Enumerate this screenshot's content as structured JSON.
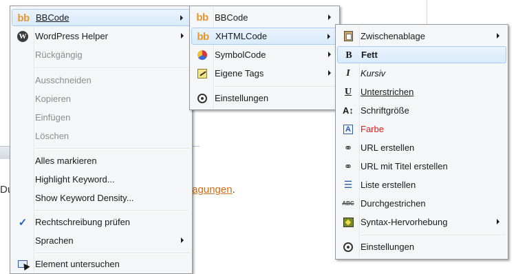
{
  "background": {
    "left_text": "Du",
    "link_text": "tragungen",
    "after_link": "."
  },
  "main_menu": {
    "items": [
      {
        "label": "BBCode",
        "icon": "bbcode-icon",
        "submenu": true,
        "highlighted": true
      },
      {
        "label": "WordPress Helper",
        "icon": "wordpress-icon",
        "submenu": true
      },
      {
        "label": "Rückgängig",
        "disabled": true
      },
      {
        "label": "Ausschneiden",
        "disabled": true
      },
      {
        "label": "Kopieren",
        "disabled": true
      },
      {
        "label": "Einfügen",
        "disabled": true
      },
      {
        "label": "Löschen",
        "disabled": true
      },
      {
        "label": "Alles markieren"
      },
      {
        "label": "Highlight Keyword..."
      },
      {
        "label": "Show Keyword Density..."
      },
      {
        "label": "Rechtschreibung prüfen",
        "icon": "checkmark-icon"
      },
      {
        "label": "Sprachen",
        "submenu": true
      },
      {
        "label": "Element untersuchen",
        "icon": "inspect-element-icon"
      }
    ]
  },
  "bbcode_menu": {
    "items": [
      {
        "label": "BBCode",
        "icon": "bbcode-icon",
        "submenu": true
      },
      {
        "label": "XHTMLCode",
        "icon": "bbcode-icon",
        "submenu": true,
        "highlighted": true
      },
      {
        "label": "SymbolCode",
        "icon": "symbol-icon",
        "submenu": true
      },
      {
        "label": "Eigene Tags",
        "icon": "tags-icon",
        "submenu": true
      },
      {
        "label": "Einstellungen",
        "icon": "settings-icon"
      }
    ]
  },
  "xhtml_menu": {
    "items": [
      {
        "label": "Zwischenablage",
        "icon": "clipboard-icon",
        "submenu": true
      },
      {
        "label": "Fett",
        "icon": "bold-icon",
        "icon_glyph": "B",
        "highlighted": true
      },
      {
        "label": "Kursiv",
        "icon": "italic-icon",
        "icon_glyph": "I"
      },
      {
        "label": "Unterstrichen",
        "icon": "underline-icon",
        "icon_glyph": "U"
      },
      {
        "label": "Schriftgröße",
        "icon": "font-size-icon",
        "icon_glyph": "A↕"
      },
      {
        "label": "Farbe",
        "icon": "color-icon",
        "icon_glyph": "A",
        "color": "#e01a1a"
      },
      {
        "label": "URL erstellen",
        "icon": "link-icon"
      },
      {
        "label": "URL mit Titel erstellen",
        "icon": "link-icon"
      },
      {
        "label": "Liste erstellen",
        "icon": "list-icon"
      },
      {
        "label": "Durchgestrichen",
        "icon": "strikethrough-icon",
        "icon_glyph": "ABC"
      },
      {
        "label": "Syntax-Hervorhebung",
        "icon": "syntax-icon",
        "submenu": true
      },
      {
        "label": "Einstellungen",
        "icon": "settings-icon"
      }
    ]
  },
  "colors": {
    "menu_bg": "#f5f6f7",
    "highlight": "#d9ebfb",
    "bbcode_orange": "#e8962c",
    "link_orange": "#d26a11",
    "color_red": "#e01a1a"
  }
}
